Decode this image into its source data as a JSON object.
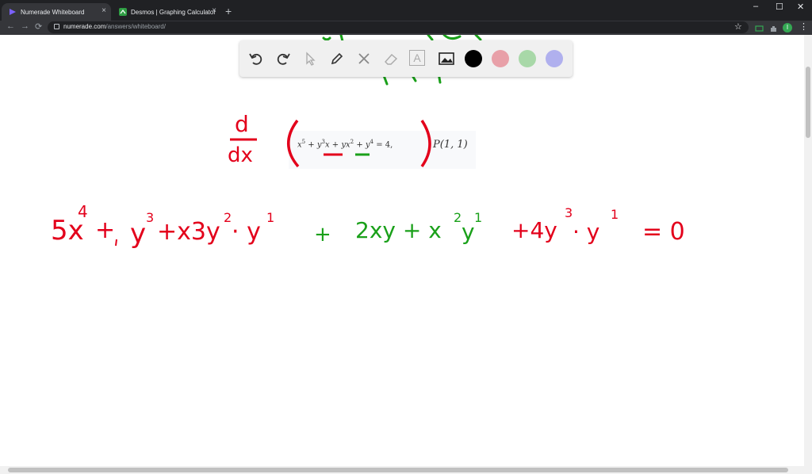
{
  "browser": {
    "tabs": [
      {
        "title": "Numerade Whiteboard",
        "close": "×"
      },
      {
        "title": "Desmos | Graphing Calculator",
        "close": "×"
      }
    ],
    "new_tab": "+",
    "window_controls": {
      "minimize": "–",
      "maximize": "☐",
      "close": "✕"
    },
    "nav": {
      "back": "←",
      "forward": "→",
      "reload": "⟳"
    },
    "url": {
      "host": "numerade.com",
      "path": "/answers/whiteboard/"
    },
    "star": "☆",
    "profile_initial": "I",
    "menu": "⋮"
  },
  "whiteboard": {
    "toolbar": {
      "tools": [
        "undo-icon",
        "redo-icon",
        "pointer-icon",
        "pen-icon",
        "tools-icon",
        "eraser-icon",
        "text-icon",
        "image-icon"
      ],
      "text_tool_label": "A",
      "colors": [
        "#000000",
        "#e8a0a8",
        "#a8d8a8",
        "#b0b0ee"
      ]
    },
    "problem": {
      "equation_parts": [
        "x",
        "5",
        " + ",
        "y",
        "3",
        "x",
        " + ",
        "yx",
        "2",
        " + ",
        "y",
        "4",
        " = 4,"
      ],
      "point": "P(1, 1)"
    },
    "ink": {
      "red": "#e3001b",
      "green": "#1aa01a",
      "derivative_operator": {
        "numerator": "d",
        "denominator": "dx"
      },
      "line1_red": "5x",
      "line1_red_exp": "4",
      "line1_plus": "+",
      "line1_term2": "y",
      "line1_term2_exp": "3",
      "line1_term3": "+x3y",
      "line1_term3_exp": "2",
      "line1_term4": "· y",
      "line1_term4_exp": "1",
      "line1_green_plus": "+",
      "line1_green": "2xy  + x",
      "line1_green_exp": "2",
      "line1_green_y": "y",
      "line1_green_y_exp": "1",
      "line1_red2": "+4y",
      "line1_red2_exp": "3",
      "line1_red2_b": "· y",
      "line1_red2_b_exp": "1",
      "line1_equals": "= 0"
    }
  }
}
